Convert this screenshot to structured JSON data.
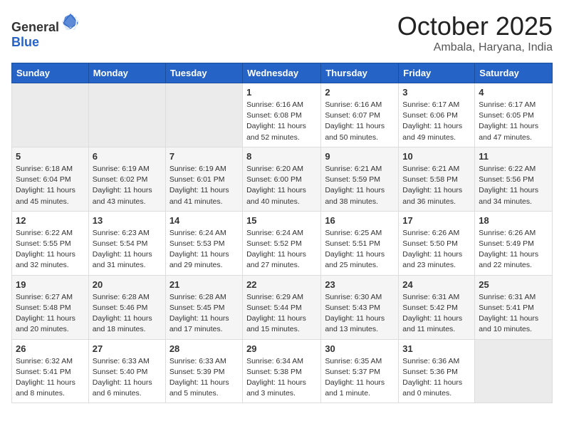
{
  "header": {
    "logo_general": "General",
    "logo_blue": "Blue",
    "month": "October 2025",
    "location": "Ambala, Haryana, India"
  },
  "weekdays": [
    "Sunday",
    "Monday",
    "Tuesday",
    "Wednesday",
    "Thursday",
    "Friday",
    "Saturday"
  ],
  "weeks": [
    [
      {
        "day": "",
        "sunrise": "",
        "sunset": "",
        "daylight": ""
      },
      {
        "day": "",
        "sunrise": "",
        "sunset": "",
        "daylight": ""
      },
      {
        "day": "",
        "sunrise": "",
        "sunset": "",
        "daylight": ""
      },
      {
        "day": "1",
        "sunrise": "Sunrise: 6:16 AM",
        "sunset": "Sunset: 6:08 PM",
        "daylight": "Daylight: 11 hours and 52 minutes."
      },
      {
        "day": "2",
        "sunrise": "Sunrise: 6:16 AM",
        "sunset": "Sunset: 6:07 PM",
        "daylight": "Daylight: 11 hours and 50 minutes."
      },
      {
        "day": "3",
        "sunrise": "Sunrise: 6:17 AM",
        "sunset": "Sunset: 6:06 PM",
        "daylight": "Daylight: 11 hours and 49 minutes."
      },
      {
        "day": "4",
        "sunrise": "Sunrise: 6:17 AM",
        "sunset": "Sunset: 6:05 PM",
        "daylight": "Daylight: 11 hours and 47 minutes."
      }
    ],
    [
      {
        "day": "5",
        "sunrise": "Sunrise: 6:18 AM",
        "sunset": "Sunset: 6:04 PM",
        "daylight": "Daylight: 11 hours and 45 minutes."
      },
      {
        "day": "6",
        "sunrise": "Sunrise: 6:19 AM",
        "sunset": "Sunset: 6:02 PM",
        "daylight": "Daylight: 11 hours and 43 minutes."
      },
      {
        "day": "7",
        "sunrise": "Sunrise: 6:19 AM",
        "sunset": "Sunset: 6:01 PM",
        "daylight": "Daylight: 11 hours and 41 minutes."
      },
      {
        "day": "8",
        "sunrise": "Sunrise: 6:20 AM",
        "sunset": "Sunset: 6:00 PM",
        "daylight": "Daylight: 11 hours and 40 minutes."
      },
      {
        "day": "9",
        "sunrise": "Sunrise: 6:21 AM",
        "sunset": "Sunset: 5:59 PM",
        "daylight": "Daylight: 11 hours and 38 minutes."
      },
      {
        "day": "10",
        "sunrise": "Sunrise: 6:21 AM",
        "sunset": "Sunset: 5:58 PM",
        "daylight": "Daylight: 11 hours and 36 minutes."
      },
      {
        "day": "11",
        "sunrise": "Sunrise: 6:22 AM",
        "sunset": "Sunset: 5:56 PM",
        "daylight": "Daylight: 11 hours and 34 minutes."
      }
    ],
    [
      {
        "day": "12",
        "sunrise": "Sunrise: 6:22 AM",
        "sunset": "Sunset: 5:55 PM",
        "daylight": "Daylight: 11 hours and 32 minutes."
      },
      {
        "day": "13",
        "sunrise": "Sunrise: 6:23 AM",
        "sunset": "Sunset: 5:54 PM",
        "daylight": "Daylight: 11 hours and 31 minutes."
      },
      {
        "day": "14",
        "sunrise": "Sunrise: 6:24 AM",
        "sunset": "Sunset: 5:53 PM",
        "daylight": "Daylight: 11 hours and 29 minutes."
      },
      {
        "day": "15",
        "sunrise": "Sunrise: 6:24 AM",
        "sunset": "Sunset: 5:52 PM",
        "daylight": "Daylight: 11 hours and 27 minutes."
      },
      {
        "day": "16",
        "sunrise": "Sunrise: 6:25 AM",
        "sunset": "Sunset: 5:51 PM",
        "daylight": "Daylight: 11 hours and 25 minutes."
      },
      {
        "day": "17",
        "sunrise": "Sunrise: 6:26 AM",
        "sunset": "Sunset: 5:50 PM",
        "daylight": "Daylight: 11 hours and 23 minutes."
      },
      {
        "day": "18",
        "sunrise": "Sunrise: 6:26 AM",
        "sunset": "Sunset: 5:49 PM",
        "daylight": "Daylight: 11 hours and 22 minutes."
      }
    ],
    [
      {
        "day": "19",
        "sunrise": "Sunrise: 6:27 AM",
        "sunset": "Sunset: 5:48 PM",
        "daylight": "Daylight: 11 hours and 20 minutes."
      },
      {
        "day": "20",
        "sunrise": "Sunrise: 6:28 AM",
        "sunset": "Sunset: 5:46 PM",
        "daylight": "Daylight: 11 hours and 18 minutes."
      },
      {
        "day": "21",
        "sunrise": "Sunrise: 6:28 AM",
        "sunset": "Sunset: 5:45 PM",
        "daylight": "Daylight: 11 hours and 17 minutes."
      },
      {
        "day": "22",
        "sunrise": "Sunrise: 6:29 AM",
        "sunset": "Sunset: 5:44 PM",
        "daylight": "Daylight: 11 hours and 15 minutes."
      },
      {
        "day": "23",
        "sunrise": "Sunrise: 6:30 AM",
        "sunset": "Sunset: 5:43 PM",
        "daylight": "Daylight: 11 hours and 13 minutes."
      },
      {
        "day": "24",
        "sunrise": "Sunrise: 6:31 AM",
        "sunset": "Sunset: 5:42 PM",
        "daylight": "Daylight: 11 hours and 11 minutes."
      },
      {
        "day": "25",
        "sunrise": "Sunrise: 6:31 AM",
        "sunset": "Sunset: 5:41 PM",
        "daylight": "Daylight: 11 hours and 10 minutes."
      }
    ],
    [
      {
        "day": "26",
        "sunrise": "Sunrise: 6:32 AM",
        "sunset": "Sunset: 5:41 PM",
        "daylight": "Daylight: 11 hours and 8 minutes."
      },
      {
        "day": "27",
        "sunrise": "Sunrise: 6:33 AM",
        "sunset": "Sunset: 5:40 PM",
        "daylight": "Daylight: 11 hours and 6 minutes."
      },
      {
        "day": "28",
        "sunrise": "Sunrise: 6:33 AM",
        "sunset": "Sunset: 5:39 PM",
        "daylight": "Daylight: 11 hours and 5 minutes."
      },
      {
        "day": "29",
        "sunrise": "Sunrise: 6:34 AM",
        "sunset": "Sunset: 5:38 PM",
        "daylight": "Daylight: 11 hours and 3 minutes."
      },
      {
        "day": "30",
        "sunrise": "Sunrise: 6:35 AM",
        "sunset": "Sunset: 5:37 PM",
        "daylight": "Daylight: 11 hours and 1 minute."
      },
      {
        "day": "31",
        "sunrise": "Sunrise: 6:36 AM",
        "sunset": "Sunset: 5:36 PM",
        "daylight": "Daylight: 11 hours and 0 minutes."
      },
      {
        "day": "",
        "sunrise": "",
        "sunset": "",
        "daylight": ""
      }
    ]
  ]
}
